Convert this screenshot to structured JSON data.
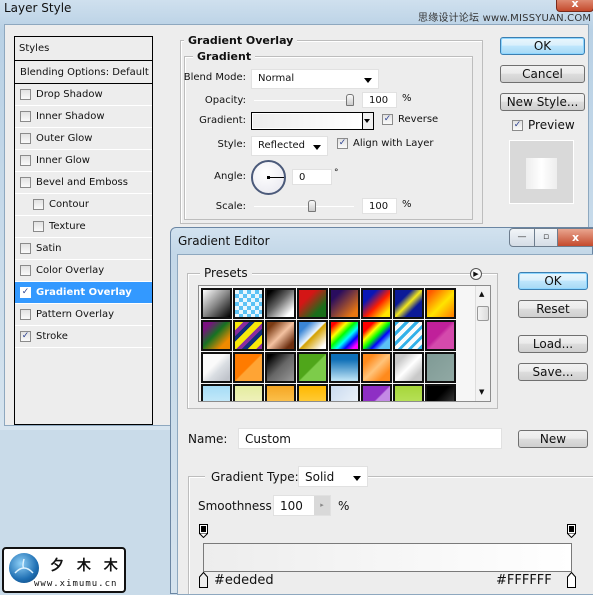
{
  "layer_style": {
    "title": "Layer Style",
    "watermark": "思缘设计论坛  www.MISSYUAN.COM",
    "close_label": "x",
    "styles_list": {
      "header": "Styles",
      "items": [
        {
          "label": "Blending Options: Default",
          "type": "plain"
        },
        {
          "label": "Drop Shadow",
          "checked": false
        },
        {
          "label": "Inner Shadow",
          "checked": false
        },
        {
          "label": "Outer Glow",
          "checked": false
        },
        {
          "label": "Inner Glow",
          "checked": false
        },
        {
          "label": "Bevel and Emboss",
          "checked": false
        },
        {
          "label": "Contour",
          "checked": false,
          "sub": true
        },
        {
          "label": "Texture",
          "checked": false,
          "sub": true
        },
        {
          "label": "Satin",
          "checked": false
        },
        {
          "label": "Color Overlay",
          "checked": false
        },
        {
          "label": "Gradient Overlay",
          "checked": true,
          "selected": true
        },
        {
          "label": "Pattern Overlay",
          "checked": false
        },
        {
          "label": "Stroke",
          "checked": true
        }
      ]
    },
    "panel": {
      "section_title": "Gradient Overlay",
      "group_title": "Gradient",
      "blend_mode_label": "Blend Mode:",
      "blend_mode_value": "Normal",
      "opacity_label": "Opacity:",
      "opacity_value": "100",
      "opacity_slider_percent": 100,
      "percent_sign": "%",
      "gradient_label": "Gradient:",
      "reverse_label": "Reverse",
      "reverse_checked": true,
      "style_label": "Style:",
      "style_value": "Reflected",
      "align_label": "Align with Layer",
      "align_checked": true,
      "angle_label": "Angle:",
      "angle_value": "0",
      "degree_sign": "°",
      "scale_label": "Scale:",
      "scale_value": "100",
      "scale_slider_percent": 60
    },
    "buttons": {
      "ok": "OK",
      "cancel": "Cancel",
      "new_style": "New Style...",
      "preview_label": "Preview",
      "preview_checked": true
    }
  },
  "gradient_editor": {
    "title": "Gradient Editor",
    "caption_buttons": {
      "minimize": "—",
      "maximize": "▫",
      "close": "x"
    },
    "presets_label": "Presets",
    "presets_menu_icon": "▶",
    "presets": [
      [
        "linear-gradient(135deg,#fff 0%,#888 50%,#000 100%)",
        "repeating-conic-gradient(#5bc2f5 0 25%,#e8f6fd 0 50%) 0 0/8px 8px",
        "linear-gradient(135deg,#000 10%,#666 45%,#fff 85%)",
        "linear-gradient(135deg,#d41616 30%,#1a6e1a 75%)",
        "linear-gradient(135deg,#2a0d5e 20%,#e87612 85%)",
        "linear-gradient(135deg,#0a17b6 25%,#ff1e00 55%,#ffe500 85%)",
        "linear-gradient(135deg,#0b1a98 30%,#f3e81c 50%,#0b1a98 70%)",
        "linear-gradient(135deg,#ff5a00 10%,#ffe400 55%,#ff7a00 100%)"
      ],
      [
        "linear-gradient(135deg,#7a1180 15%,#167222 45%,#f08a00 80%)",
        "repeating-linear-gradient(135deg,#f7e90a 0 6px,#8a2d9f 6px 10px,#10307a 10px 14px)",
        "linear-gradient(135deg,#7b3b14 15%,#f4c2a1 50%,#6d2f10 85%)",
        "linear-gradient(135deg,#3b86d6 20%,#eef6fd 48%,#d4a100 52%,#fff 90%)",
        "linear-gradient(135deg,#ff0000 10%,#ff0 30%,#0f0 45%,#0ff 60%,#00f 75%,#f0f 90%)",
        "linear-gradient(135deg,#f00 20%,#ff0 35%,#0f0 50%,#00f 65%,#5bc2f5 80%)",
        "repeating-linear-gradient(135deg,#33b1e9 0 3px,#fafafa 3px 7px)",
        "linear-gradient(135deg,#c0209a 45%,#d44aac 55%)"
      ],
      [
        "linear-gradient(135deg,#fafafa 40%,#d9dde2 60%,#c0c4cb 90%)",
        "linear-gradient(135deg,#ff7b00 48%,#ffa434 52%)",
        "linear-gradient(135deg,#000 10%,#666 50%,#999 100%)",
        "linear-gradient(135deg,#4fa61a 48%,#7dcc4a 52%)",
        "linear-gradient(180deg,#0e6fb7 20%,#b9e0f4 95%)",
        "linear-gradient(135deg,#ff8a1c 20%,#ffc37a 50%,#ff8a1c 80%)",
        "linear-gradient(135deg,#c9c9c9 20%,#fff 50%,#c9c9c9 80%)",
        "linear-gradient(135deg,#7f9a95,#91a9a4)"
      ],
      [
        "linear-gradient(180deg,#a5dcf6,#d8f1fb)",
        "linear-gradient(180deg,#e4ec9f,#f7f5cf)",
        "linear-gradient(180deg,#f5a623,#ffd36a)",
        "linear-gradient(180deg,#ffb800,#ffd85e)",
        "linear-gradient(135deg,#c9daef,#f4f8fc)",
        "linear-gradient(135deg,#8e2fc4 48%,#c38ae5 52%)",
        "linear-gradient(180deg,#a6d63a,#c2e86b)",
        "linear-gradient(135deg,#000 40%,#555 100%)"
      ]
    ],
    "buttons": {
      "ok": "OK",
      "reset": "Reset",
      "load": "Load...",
      "save": "Save...",
      "new": "New"
    },
    "name_label": "Name:",
    "name_value": "Custom",
    "gradient_type_label": "Gradient Type:",
    "gradient_type_value": "Solid",
    "smoothness_label": "Smoothness:",
    "smoothness_value": "100",
    "smoothness_unit": "%",
    "gradient_colors": {
      "start": "#ededed",
      "end": "#FFFFFF"
    },
    "stop_labels": {
      "left": "#ededed",
      "right": "#FFFFFF"
    }
  },
  "logo": {
    "text": "夕 木 木",
    "url": "www.ximumu.cn"
  }
}
